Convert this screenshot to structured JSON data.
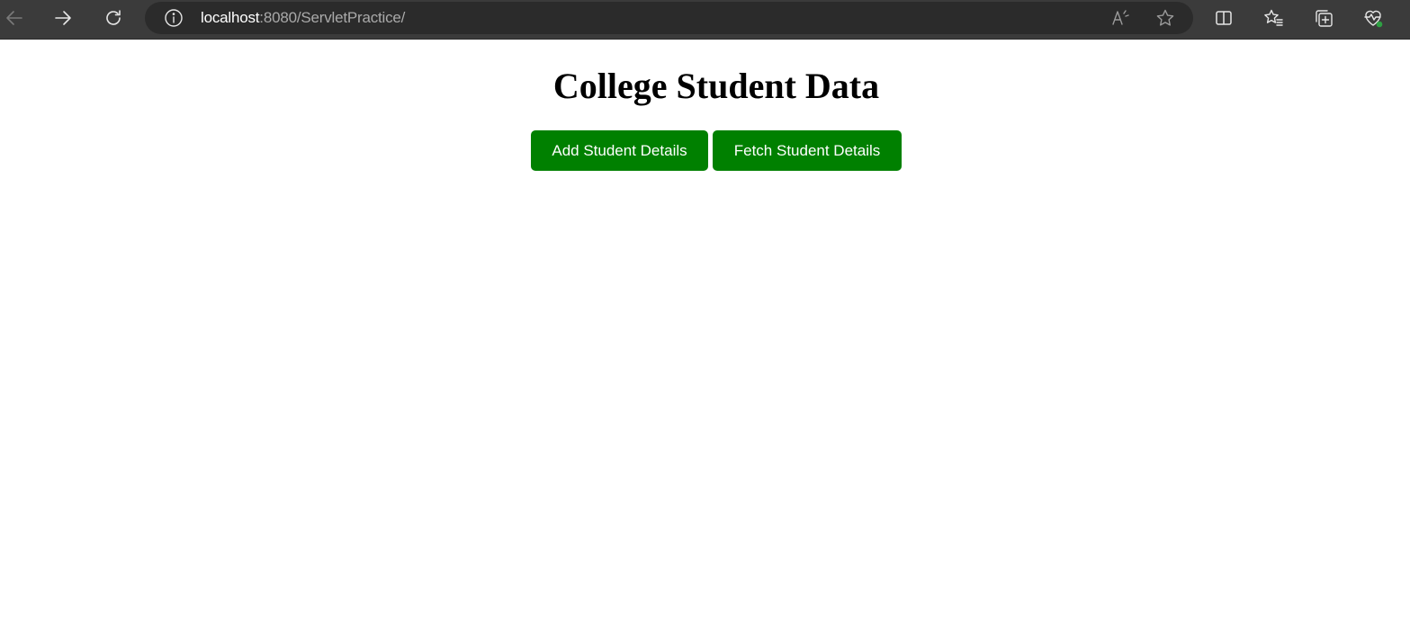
{
  "browser": {
    "url_host": "localhost",
    "url_rest": ":8080/ServletPractice/",
    "icons": {
      "back": "back-arrow-icon",
      "forward": "forward-arrow-icon",
      "refresh": "refresh-icon",
      "site_info": "info-icon",
      "read_aloud": "read-aloud-icon",
      "favorite": "star-icon",
      "split_screen": "split-screen-icon",
      "favorites": "favorites-icon",
      "collections": "collections-icon",
      "browser_essentials": "heartbeat-icon"
    },
    "colors": {
      "toolbar": "#3b3b3b",
      "addressbar": "#2b2b2b",
      "essentials_badge": "#2ea043"
    }
  },
  "page": {
    "title": "College Student Data",
    "buttons": {
      "add_label": "Add Student Details",
      "fetch_label": "Fetch Student Details"
    },
    "colors": {
      "button_bg": "#008000",
      "button_text": "#ffffff"
    }
  }
}
